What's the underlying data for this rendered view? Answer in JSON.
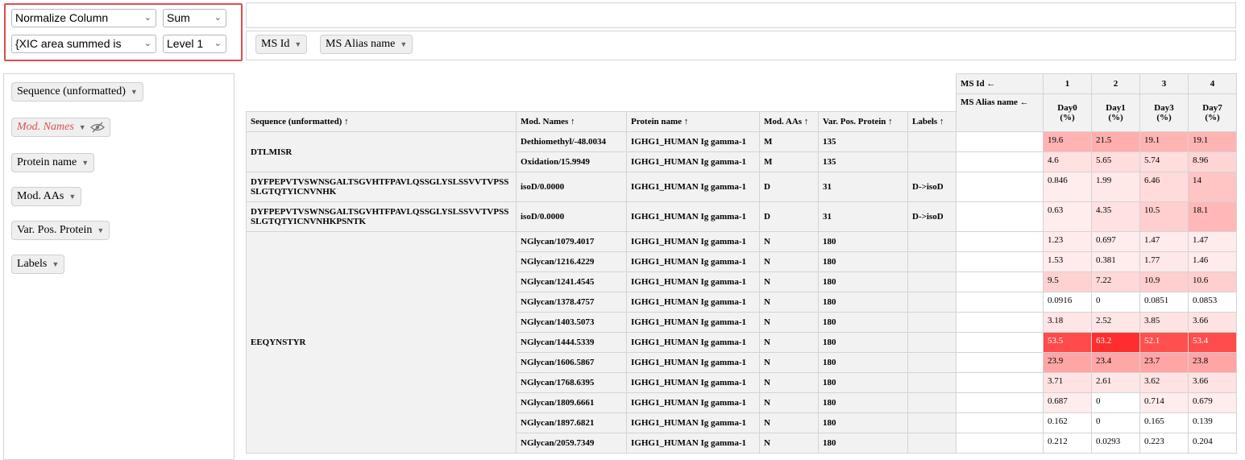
{
  "controls": {
    "aggregator_label": "Normalize Column",
    "aggregator_fn": "Sum",
    "value_field": "{XIC area summed is",
    "level": "Level 1"
  },
  "col_attrs": [
    {
      "label": "MS Id"
    },
    {
      "label": "MS Alias name"
    }
  ],
  "row_attrs": [
    {
      "label": "Sequence (unformatted)",
      "style": "normal"
    },
    {
      "label": "Mod. Names",
      "style": "hidden"
    },
    {
      "label": "Protein name",
      "style": "normal"
    },
    {
      "label": "Mod. AAs",
      "style": "normal"
    },
    {
      "label": "Var. Pos. Protein",
      "style": "normal"
    },
    {
      "label": "Labels",
      "style": "normal"
    }
  ],
  "table": {
    "col_header_labels": [
      "MS Id ←",
      "MS Alias name ←"
    ],
    "row_headers": [
      "Sequence (unformatted) ↑",
      "Mod. Names ↑",
      "Protein name ↑",
      "Mod. AAs ↑",
      "Var. Pos. Protein ↑",
      "Labels ↑"
    ],
    "ms_ids": [
      "1",
      "2",
      "3",
      "4"
    ],
    "aliases": [
      "Day0\n(%)",
      "Day1\n(%)",
      "Day3\n(%)",
      "Day7\n(%)"
    ],
    "rows": [
      {
        "seq": "DTLMISR",
        "mod": "Dethiomethyl/-48.0034",
        "protein": "IGHG1_HUMAN Ig gamma-1",
        "aa": "M",
        "pos": "135",
        "label": "",
        "values": [
          "19.6",
          "21.5",
          "19.1",
          "19.1"
        ],
        "fracs": [
          0.31,
          0.34,
          0.3,
          0.3
        ]
      },
      {
        "seq": "",
        "mod": "Oxidation/15.9949",
        "protein": "IGHG1_HUMAN Ig gamma-1",
        "aa": "M",
        "pos": "135",
        "label": "",
        "values": [
          "4.6",
          "5.65",
          "5.74",
          "8.96"
        ],
        "fracs": [
          0.07,
          0.09,
          0.09,
          0.14
        ]
      },
      {
        "seq": "DYFPEPVTVSWNSGALTSGVHTFPAVLQSSGLYSLSSVVTVPSS SLGTQTYICNVNHK",
        "mod": "isoD/0.0000",
        "protein": "IGHG1_HUMAN Ig gamma-1",
        "aa": "D",
        "pos": "31",
        "label": "D->isoD",
        "values": [
          "0.846",
          "1.99",
          "6.46",
          "14"
        ],
        "fracs": [
          0.01,
          0.03,
          0.1,
          0.22
        ]
      },
      {
        "seq": "DYFPEPVTVSWNSGALTSGVHTFPAVLQSSGLYSLSSVVTVPSS SLGTQTYICNVNHKPSNTK",
        "mod": "isoD/0.0000",
        "protein": "IGHG1_HUMAN Ig gamma-1",
        "aa": "D",
        "pos": "31",
        "label": "D->isoD",
        "values": [
          "0.63",
          "4.35",
          "10.5",
          "18.1"
        ],
        "fracs": [
          0.01,
          0.07,
          0.17,
          0.29
        ]
      },
      {
        "seq": "EEQYNSTYR",
        "mod": "NGlycan/1079.4017",
        "protein": "IGHG1_HUMAN Ig gamma-1",
        "aa": "N",
        "pos": "180",
        "label": "",
        "values": [
          "1.23",
          "0.697",
          "1.47",
          "1.47"
        ],
        "fracs": [
          0.02,
          0.01,
          0.02,
          0.02
        ]
      },
      {
        "seq": "",
        "mod": "NGlycan/1216.4229",
        "protein": "IGHG1_HUMAN Ig gamma-1",
        "aa": "N",
        "pos": "180",
        "label": "",
        "values": [
          "1.53",
          "0.381",
          "1.77",
          "1.46"
        ],
        "fracs": [
          0.02,
          0.01,
          0.03,
          0.02
        ]
      },
      {
        "seq": "",
        "mod": "NGlycan/1241.4545",
        "protein": "IGHG1_HUMAN Ig gamma-1",
        "aa": "N",
        "pos": "180",
        "label": "",
        "values": [
          "9.5",
          "7.22",
          "10.9",
          "10.6"
        ],
        "fracs": [
          0.15,
          0.11,
          0.17,
          0.17
        ]
      },
      {
        "seq": "",
        "mod": "NGlycan/1378.4757",
        "protein": "IGHG1_HUMAN Ig gamma-1",
        "aa": "N",
        "pos": "180",
        "label": "",
        "values": [
          "0.0916",
          "0",
          "0.0851",
          "0.0853"
        ],
        "fracs": [
          0,
          0,
          0,
          0
        ]
      },
      {
        "seq": "",
        "mod": "NGlycan/1403.5073",
        "protein": "IGHG1_HUMAN Ig gamma-1",
        "aa": "N",
        "pos": "180",
        "label": "",
        "values": [
          "3.18",
          "2.52",
          "3.85",
          "3.66"
        ],
        "fracs": [
          0.05,
          0.04,
          0.06,
          0.06
        ]
      },
      {
        "seq": "",
        "mod": "NGlycan/1444.5339",
        "protein": "IGHG1_HUMAN Ig gamma-1",
        "aa": "N",
        "pos": "180",
        "label": "",
        "values": [
          "53.5",
          "63.2",
          "52.1",
          "53.4"
        ],
        "fracs": [
          0.85,
          1.0,
          0.82,
          0.84
        ]
      },
      {
        "seq": "",
        "mod": "NGlycan/1606.5867",
        "protein": "IGHG1_HUMAN Ig gamma-1",
        "aa": "N",
        "pos": "180",
        "label": "",
        "values": [
          "23.9",
          "23.4",
          "23.7",
          "23.8"
        ],
        "fracs": [
          0.38,
          0.37,
          0.38,
          0.38
        ]
      },
      {
        "seq": "",
        "mod": "NGlycan/1768.6395",
        "protein": "IGHG1_HUMAN Ig gamma-1",
        "aa": "N",
        "pos": "180",
        "label": "",
        "values": [
          "3.71",
          "2.61",
          "3.62",
          "3.66"
        ],
        "fracs": [
          0.06,
          0.04,
          0.06,
          0.06
        ]
      },
      {
        "seq": "",
        "mod": "NGlycan/1809.6661",
        "protein": "IGHG1_HUMAN Ig gamma-1",
        "aa": "N",
        "pos": "180",
        "label": "",
        "values": [
          "0.687",
          "0",
          "0.714",
          "0.679"
        ],
        "fracs": [
          0.01,
          0,
          0.01,
          0.01
        ]
      },
      {
        "seq": "",
        "mod": "NGlycan/1897.6821",
        "protein": "IGHG1_HUMAN Ig gamma-1",
        "aa": "N",
        "pos": "180",
        "label": "",
        "values": [
          "0.162",
          "0",
          "0.165",
          "0.139"
        ],
        "fracs": [
          0,
          0,
          0,
          0
        ]
      },
      {
        "seq": "",
        "mod": "NGlycan/2059.7349",
        "protein": "IGHG1_HUMAN Ig gamma-1",
        "aa": "N",
        "pos": "180",
        "label": "",
        "values": [
          "0.212",
          "0.0293",
          "0.223",
          "0.204"
        ],
        "fracs": [
          0,
          0,
          0,
          0
        ]
      }
    ],
    "heat_color": "#ff2e2e"
  }
}
